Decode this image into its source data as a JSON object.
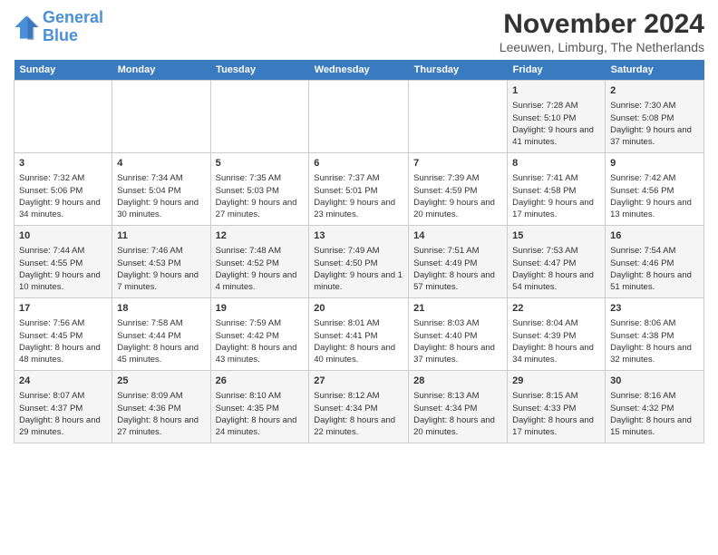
{
  "header": {
    "logo_line1": "General",
    "logo_line2": "Blue",
    "title": "November 2024",
    "subtitle": "Leeuwen, Limburg, The Netherlands"
  },
  "days_of_week": [
    "Sunday",
    "Monday",
    "Tuesday",
    "Wednesday",
    "Thursday",
    "Friday",
    "Saturday"
  ],
  "weeks": [
    [
      {
        "day": "",
        "content": ""
      },
      {
        "day": "",
        "content": ""
      },
      {
        "day": "",
        "content": ""
      },
      {
        "day": "",
        "content": ""
      },
      {
        "day": "",
        "content": ""
      },
      {
        "day": "1",
        "content": "Sunrise: 7:28 AM\nSunset: 5:10 PM\nDaylight: 9 hours and 41 minutes."
      },
      {
        "day": "2",
        "content": "Sunrise: 7:30 AM\nSunset: 5:08 PM\nDaylight: 9 hours and 37 minutes."
      }
    ],
    [
      {
        "day": "3",
        "content": "Sunrise: 7:32 AM\nSunset: 5:06 PM\nDaylight: 9 hours and 34 minutes."
      },
      {
        "day": "4",
        "content": "Sunrise: 7:34 AM\nSunset: 5:04 PM\nDaylight: 9 hours and 30 minutes."
      },
      {
        "day": "5",
        "content": "Sunrise: 7:35 AM\nSunset: 5:03 PM\nDaylight: 9 hours and 27 minutes."
      },
      {
        "day": "6",
        "content": "Sunrise: 7:37 AM\nSunset: 5:01 PM\nDaylight: 9 hours and 23 minutes."
      },
      {
        "day": "7",
        "content": "Sunrise: 7:39 AM\nSunset: 4:59 PM\nDaylight: 9 hours and 20 minutes."
      },
      {
        "day": "8",
        "content": "Sunrise: 7:41 AM\nSunset: 4:58 PM\nDaylight: 9 hours and 17 minutes."
      },
      {
        "day": "9",
        "content": "Sunrise: 7:42 AM\nSunset: 4:56 PM\nDaylight: 9 hours and 13 minutes."
      }
    ],
    [
      {
        "day": "10",
        "content": "Sunrise: 7:44 AM\nSunset: 4:55 PM\nDaylight: 9 hours and 10 minutes."
      },
      {
        "day": "11",
        "content": "Sunrise: 7:46 AM\nSunset: 4:53 PM\nDaylight: 9 hours and 7 minutes."
      },
      {
        "day": "12",
        "content": "Sunrise: 7:48 AM\nSunset: 4:52 PM\nDaylight: 9 hours and 4 minutes."
      },
      {
        "day": "13",
        "content": "Sunrise: 7:49 AM\nSunset: 4:50 PM\nDaylight: 9 hours and 1 minute."
      },
      {
        "day": "14",
        "content": "Sunrise: 7:51 AM\nSunset: 4:49 PM\nDaylight: 8 hours and 57 minutes."
      },
      {
        "day": "15",
        "content": "Sunrise: 7:53 AM\nSunset: 4:47 PM\nDaylight: 8 hours and 54 minutes."
      },
      {
        "day": "16",
        "content": "Sunrise: 7:54 AM\nSunset: 4:46 PM\nDaylight: 8 hours and 51 minutes."
      }
    ],
    [
      {
        "day": "17",
        "content": "Sunrise: 7:56 AM\nSunset: 4:45 PM\nDaylight: 8 hours and 48 minutes."
      },
      {
        "day": "18",
        "content": "Sunrise: 7:58 AM\nSunset: 4:44 PM\nDaylight: 8 hours and 45 minutes."
      },
      {
        "day": "19",
        "content": "Sunrise: 7:59 AM\nSunset: 4:42 PM\nDaylight: 8 hours and 43 minutes."
      },
      {
        "day": "20",
        "content": "Sunrise: 8:01 AM\nSunset: 4:41 PM\nDaylight: 8 hours and 40 minutes."
      },
      {
        "day": "21",
        "content": "Sunrise: 8:03 AM\nSunset: 4:40 PM\nDaylight: 8 hours and 37 minutes."
      },
      {
        "day": "22",
        "content": "Sunrise: 8:04 AM\nSunset: 4:39 PM\nDaylight: 8 hours and 34 minutes."
      },
      {
        "day": "23",
        "content": "Sunrise: 8:06 AM\nSunset: 4:38 PM\nDaylight: 8 hours and 32 minutes."
      }
    ],
    [
      {
        "day": "24",
        "content": "Sunrise: 8:07 AM\nSunset: 4:37 PM\nDaylight: 8 hours and 29 minutes."
      },
      {
        "day": "25",
        "content": "Sunrise: 8:09 AM\nSunset: 4:36 PM\nDaylight: 8 hours and 27 minutes."
      },
      {
        "day": "26",
        "content": "Sunrise: 8:10 AM\nSunset: 4:35 PM\nDaylight: 8 hours and 24 minutes."
      },
      {
        "day": "27",
        "content": "Sunrise: 8:12 AM\nSunset: 4:34 PM\nDaylight: 8 hours and 22 minutes."
      },
      {
        "day": "28",
        "content": "Sunrise: 8:13 AM\nSunset: 4:34 PM\nDaylight: 8 hours and 20 minutes."
      },
      {
        "day": "29",
        "content": "Sunrise: 8:15 AM\nSunset: 4:33 PM\nDaylight: 8 hours and 17 minutes."
      },
      {
        "day": "30",
        "content": "Sunrise: 8:16 AM\nSunset: 4:32 PM\nDaylight: 8 hours and 15 minutes."
      }
    ]
  ]
}
